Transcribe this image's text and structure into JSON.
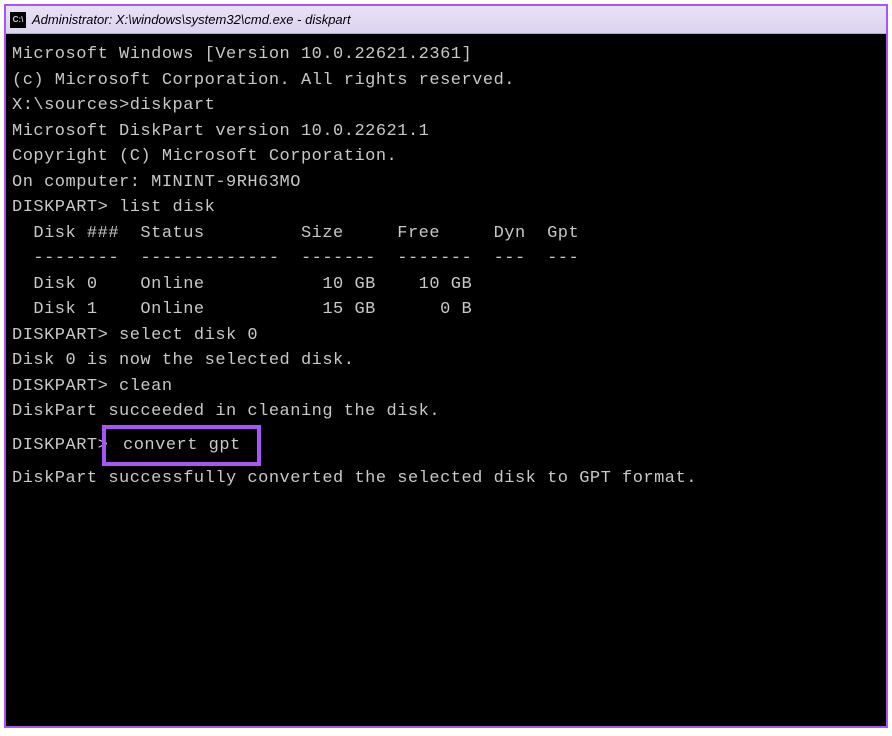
{
  "titlebar": {
    "icon_text": "C:\\",
    "title": "Administrator: X:\\windows\\system32\\cmd.exe - diskpart"
  },
  "terminal": {
    "lines": {
      "ms_windows": "Microsoft Windows [Version 10.0.22621.2361]",
      "copyright1": "(c) Microsoft Corporation. All rights reserved.",
      "blank1": "",
      "prompt_diskpart": "X:\\sources>diskpart",
      "blank2": "",
      "dp_version": "Microsoft DiskPart version 10.0.22621.1",
      "blank3": "",
      "dp_copyright": "Copyright (C) Microsoft Corporation.",
      "computer": "On computer: MININT-9RH63MO",
      "blank4": "",
      "cmd_list": "DISKPART> list disk",
      "blank5": "",
      "table_header": "  Disk ###  Status         Size     Free     Dyn  Gpt",
      "table_divider": "  --------  -------------  -------  -------  ---  ---",
      "disk0": "  Disk 0    Online           10 GB    10 GB",
      "disk1": "  Disk 1    Online           15 GB      0 B",
      "blank6": "",
      "cmd_select": "DISKPART> select disk 0",
      "blank7": "",
      "result_select": "Disk 0 is now the selected disk.",
      "blank8": "",
      "cmd_clean": "DISKPART> clean",
      "blank9": "",
      "result_clean": "DiskPart succeeded in cleaning the disk.",
      "blank10": "",
      "prompt_convert_prefix": "DISKPART>",
      "cmd_convert": " convert gpt ",
      "blank11": "",
      "result_convert": "DiskPart successfully converted the selected disk to GPT format."
    }
  }
}
